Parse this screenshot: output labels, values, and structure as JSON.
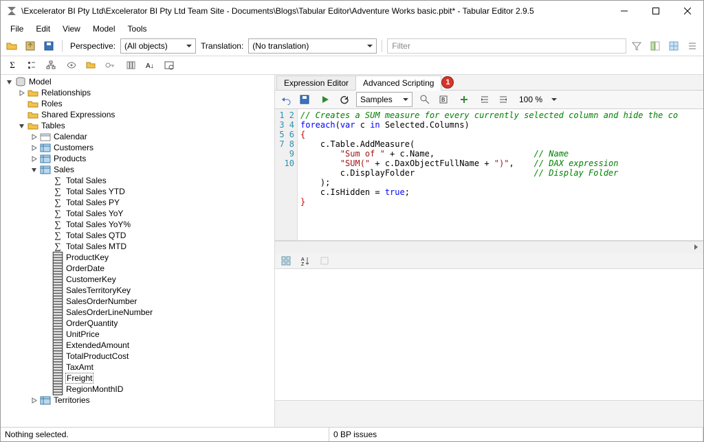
{
  "titlebar": {
    "title": "\\Excelerator BI Pty Ltd\\Excelerator BI Pty Ltd Team Site - Documents\\Blogs\\Tabular Editor\\Adventure Works basic.pbit* - Tabular Editor 2.9.5"
  },
  "menu": {
    "file": "File",
    "edit": "Edit",
    "view": "View",
    "model": "Model",
    "tools": "Tools"
  },
  "toolbar": {
    "perspective_label": "Perspective:",
    "perspective_value": "(All objects)",
    "translation_label": "Translation:",
    "translation_value": "(No translation)",
    "filter_placeholder": "Filter"
  },
  "tree": {
    "root": "Model",
    "relationships": "Relationships",
    "roles": "Roles",
    "shared_expr": "Shared Expressions",
    "tables": "Tables",
    "calendar": "Calendar",
    "customers": "Customers",
    "products": "Products",
    "sales": "Sales",
    "territories": "Territories",
    "measures": [
      "Total Sales",
      "Total Sales YTD",
      "Total Sales PY",
      "Total Sales YoY",
      "Total Sales YoY%",
      "Total Sales QTD",
      "Total Sales MTD"
    ],
    "columns": [
      "ProductKey",
      "OrderDate",
      "CustomerKey",
      "SalesTerritoryKey",
      "SalesOrderNumber",
      "SalesOrderLineNumber",
      "OrderQuantity",
      "UnitPrice",
      "ExtendedAmount",
      "TotalProductCost",
      "TaxAmt",
      "Freight",
      "RegionMonthID"
    ]
  },
  "tabs": {
    "expr": "Expression Editor",
    "script": "Advanced Scripting",
    "callout": "1"
  },
  "scriptbar": {
    "samples": "Samples",
    "zoom": "100 %"
  },
  "code": {
    "line_numbers": [
      "1",
      "2",
      "3",
      "4",
      "5",
      "6",
      "7",
      "8",
      "9",
      "10"
    ],
    "l1_comment": "// Creates a SUM measure for every currently selected column and hide the co",
    "l2_foreach": "foreach",
    "l2_var": "var",
    "l2_in": "in",
    "l2_rest1": "(",
    "l2_rest2": " c ",
    "l2_rest3": " Selected.Columns)",
    "l3": "{",
    "l4": "    c.Table.AddMeasure(",
    "l5_s": "\"Sum of \"",
    "l5_rest": " + c.Name,",
    "l5_pad": "                    ",
    "l5_c": "// Name",
    "l6_s1": "\"SUM(\"",
    "l6_mid": " + c.DaxObjectFullName + ",
    "l6_s2": "\")\"",
    "l6_tail": ",",
    "l6_pad": "    ",
    "l6_c": "// DAX expression",
    "l7_body": "        c.DisplayFolder",
    "l7_pad": "                        ",
    "l7_c": "// Display Folder",
    "l8": "    );",
    "l9_a": "    c.IsHidden = ",
    "l9_true": "true",
    "l9_b": ";",
    "l10": "}"
  },
  "status": {
    "selection": "Nothing selected.",
    "bp": "0 BP issues"
  }
}
